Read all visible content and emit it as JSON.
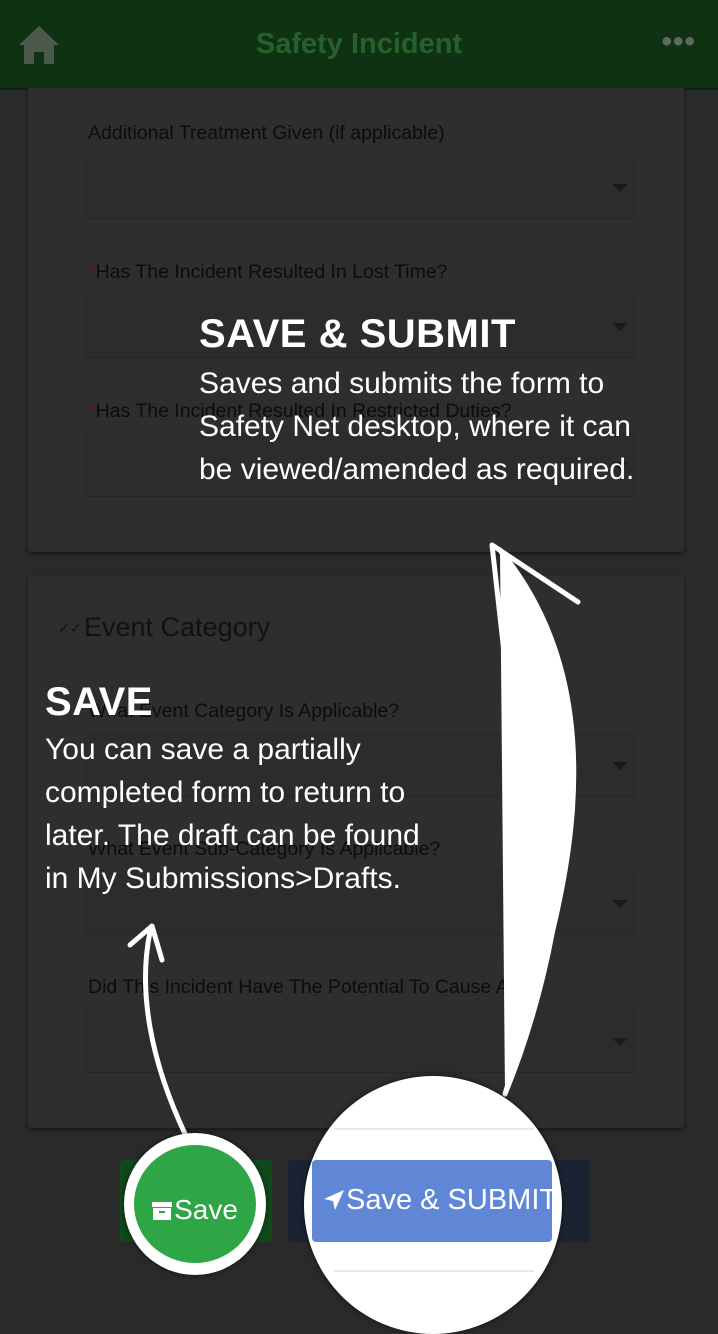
{
  "header": {
    "title": "Safety Incident",
    "home_icon": "home-icon",
    "more_icon": "more-icon",
    "more_glyph": "•••",
    "color": "#0f3312"
  },
  "card1": {
    "questions": [
      {
        "label": "Additional Treatment Given (if applicable)",
        "required": false
      },
      {
        "label": "Has The Incident Resulted In Lost Time?",
        "required": true
      },
      {
        "label": "Has The Incident Resulted In Restricted Duties?",
        "required": true
      }
    ]
  },
  "card2": {
    "section_title": "Event Category",
    "questions": [
      {
        "label": "What Event Category Is Applicable?",
        "required": false
      },
      {
        "label": "What Event Sub-Category Is Applicable?",
        "required": false
      },
      {
        "label": "Did This Incident Have The Potential To Cause A ...",
        "required": false
      }
    ]
  },
  "required_mark": "*",
  "overlay": {
    "submit_title": "SAVE & SUBMIT",
    "submit_text": "Saves and submits the form to\nSafety Net desktop, where it can\nbe viewed/amended as required.",
    "save_title": "SAVE",
    "save_text": "You can save a partially\ncompleted form to return to\nlater. The draft can be found\nin My Submissions>Drafts."
  },
  "buttons": {
    "save_label": "Save",
    "submit_label": "Save & SUBMIT",
    "save_color": "#2fa646",
    "submit_color": "#5f87d6"
  }
}
